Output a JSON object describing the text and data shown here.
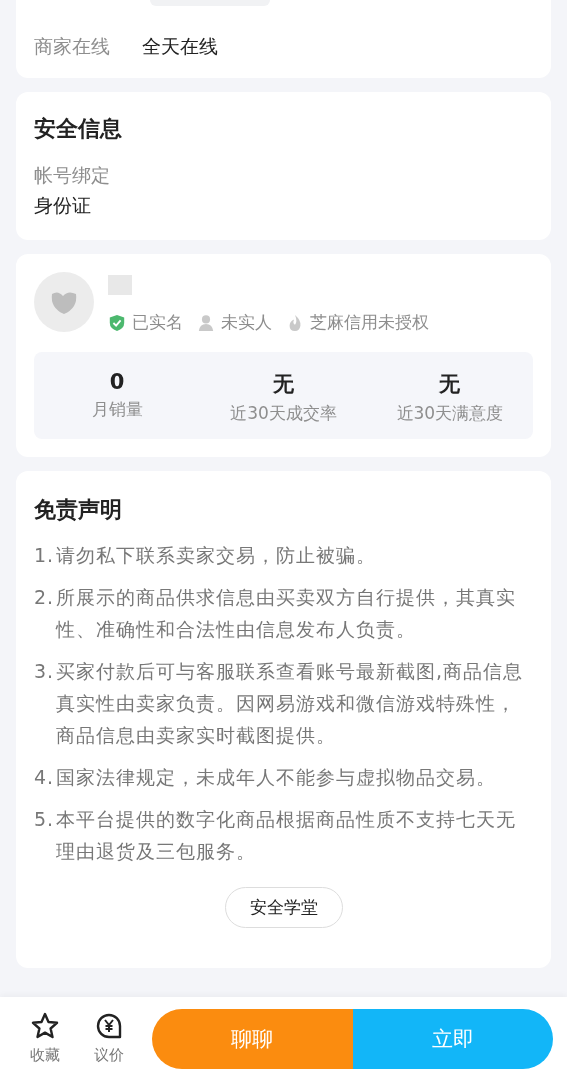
{
  "merchant_online": {
    "label": "商家在线",
    "value": "全天在线"
  },
  "security": {
    "title": "安全信息",
    "fields": [
      {
        "label": "帐号绑定",
        "value": "身份证"
      }
    ]
  },
  "seller": {
    "badges": [
      {
        "kind": "verified",
        "label": "已实名"
      },
      {
        "kind": "person",
        "label": "未实人"
      },
      {
        "kind": "credit",
        "label": "芝麻信用未授权"
      }
    ],
    "stats": [
      {
        "value": "0",
        "label": "月销量"
      },
      {
        "value": "无",
        "label": "近30天成交率"
      },
      {
        "value": "无",
        "label": "近30天满意度"
      }
    ]
  },
  "disclaimer": {
    "title": "免责声明",
    "items": [
      {
        "number": "1.",
        "text": "请勿私下联系卖家交易，防止被骗。"
      },
      {
        "number": "2.",
        "text": "所展示的商品供求信息由买卖双方自行提供，其真实性、准确性和合法性由信息发布人负责。"
      },
      {
        "number": "3.",
        "text": "买家付款后可与客服联系查看账号最新截图,商品信息真实性由卖家负责。因网易游戏和微信游戏特殊性，商品信息由卖家实时截图提供。"
      },
      {
        "number": "4.",
        "text": "国家法律规定，未成年人不能参与虚拟物品交易。"
      },
      {
        "number": "5.",
        "text": "本平台提供的数字化商品根据商品性质不支持七天无理由退货及三包服务。"
      }
    ],
    "button": "安全学堂"
  },
  "bottom_bar": {
    "actions": [
      {
        "kind": "favorite",
        "label": "收藏"
      },
      {
        "kind": "bargain",
        "label": "议价"
      }
    ],
    "chat_button": "聊聊",
    "buy_button": "立即"
  }
}
